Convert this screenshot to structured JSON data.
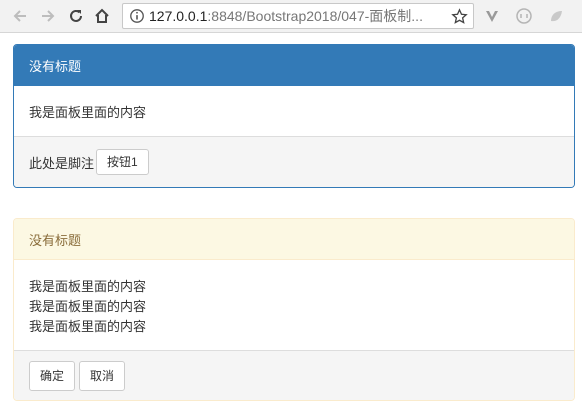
{
  "browser": {
    "url_host": "127.0.0.1",
    "url_path": ":8848/Bootstrap2018/047-面板制..."
  },
  "panel1": {
    "heading": "没有标题",
    "body": "我是面板里面的内容",
    "footer_text": "此处是脚注",
    "button_label": "按钮1"
  },
  "panel2": {
    "heading": "没有标题",
    "body_lines": [
      "我是面板里面的内容",
      "我是面板里面的内容",
      "我是面板里面的内容"
    ],
    "ok_label": "确定",
    "cancel_label": "取消"
  },
  "colors": {
    "primary": "#337ab7",
    "warning_bg": "#fcf8e3",
    "warning_text": "#8a6d3b"
  }
}
